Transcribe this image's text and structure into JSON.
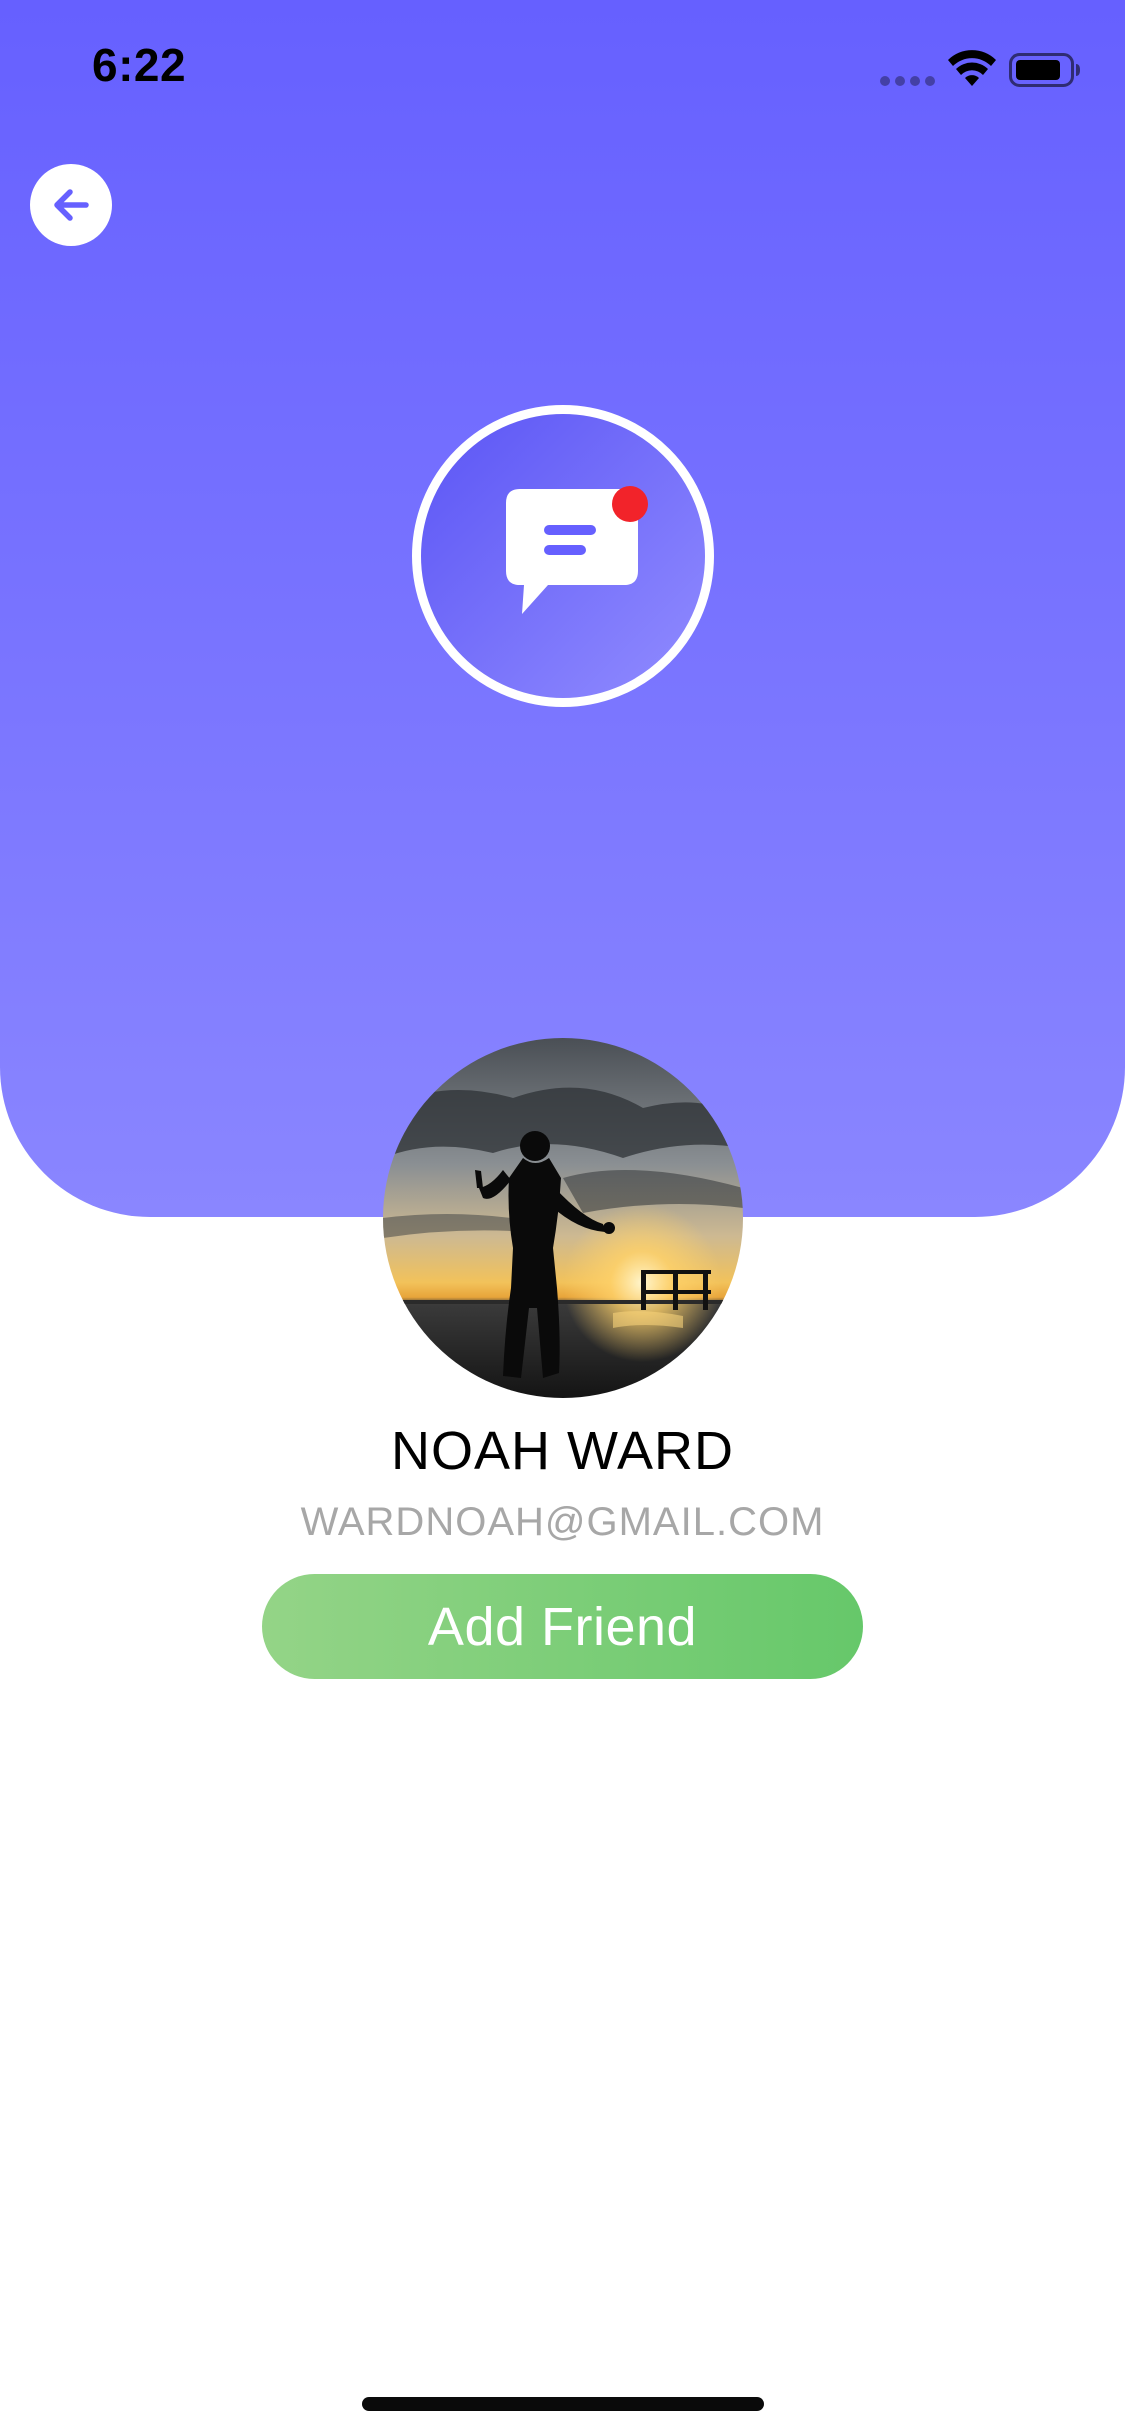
{
  "colors": {
    "header_top": "#6660ff",
    "header_bottom": "#8a86ff",
    "accent": "#6660ff",
    "notification": "#f2232a",
    "button_start": "#94d487",
    "button_end": "#66c86a",
    "email_text": "#a7a7a7"
  },
  "status_bar": {
    "time": "6:22",
    "icons": [
      "signal-icon",
      "wifi-icon",
      "battery-icon"
    ]
  },
  "header": {
    "back_icon": "arrow-left-icon",
    "badge_icon": "chat-bubble-icon",
    "has_notification": true
  },
  "profile": {
    "avatar": "profile-photo",
    "name": "NOAH WARD",
    "email": "WARDNOAH@GMAIL.COM"
  },
  "actions": {
    "add_friend_label": "Add Friend"
  }
}
